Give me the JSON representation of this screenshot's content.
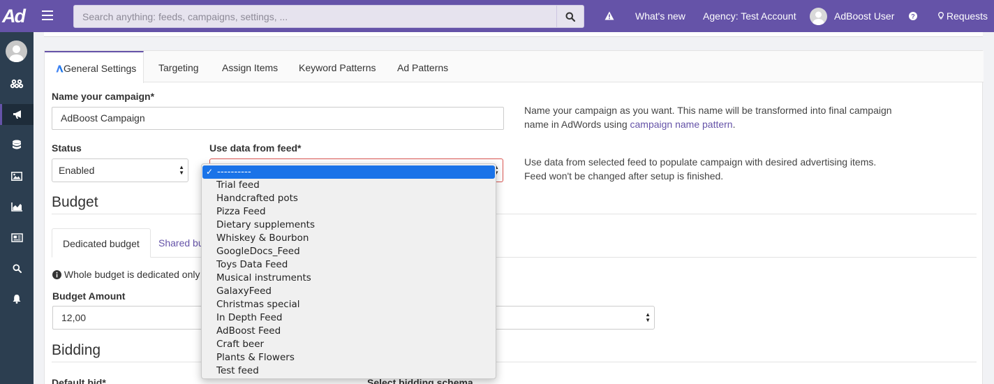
{
  "topbar": {
    "logo": "Ad",
    "search_placeholder": "Search anything: feeds, campaigns, settings, ...",
    "whats_new": "What's new",
    "agency": "Agency: Test Account",
    "user": "AdBoost User",
    "requests": "Requests"
  },
  "tabs": [
    "General Settings",
    "Targeting",
    "Assign Items",
    "Keyword Patterns",
    "Ad Patterns"
  ],
  "form": {
    "campaign_name_label": "Name your campaign*",
    "campaign_name_value": "AdBoost Campaign",
    "campaign_help_text": "Name your campaign as you want. This name will be transformed into final campaign name in AdWords using ",
    "campaign_help_link": "campaign name pattern",
    "campaign_help_end": ".",
    "status_label": "Status",
    "status_value": "Enabled",
    "feed_label": "Use data from feed*",
    "feed_help_text": "Use data from selected feed to populate campaign with desired advertising items. Feed won't be changed after setup is finished."
  },
  "budget": {
    "title": "Budget",
    "tabs": [
      "Dedicated budget",
      "Shared bud"
    ],
    "info_text": "Whole budget is dedicated only to",
    "amount_label": "Budget Amount",
    "amount_value": "12,00"
  },
  "bidding": {
    "title": "Bidding",
    "default_bid_label": "Default bid*",
    "schema_label": "Select bidding schema"
  },
  "feed_dropdown": {
    "selected": "----------",
    "options": [
      "----------",
      "Trial feed",
      "Handcrafted pots",
      "Pizza Feed",
      "Dietary supplements",
      "Whiskey & Bourbon",
      "GoogleDocs_Feed",
      "Toys Data Feed",
      "Musical instruments",
      "GalaxyFeed",
      "Christmas special",
      "In Depth Feed",
      "AdBoost Feed",
      "Craft beer",
      "Plants & Flowers",
      "Test feed"
    ]
  },
  "colors": {
    "brand": "#6553a8",
    "sidebar": "#2c3e50",
    "selection": "#1a73e8",
    "error_border": "#d9534f"
  },
  "sidebar_icons": [
    "user-avatar",
    "feeds-icon",
    "campaigns-icon",
    "database-icon",
    "image-icon",
    "chart-icon",
    "newspaper-icon",
    "search-icon",
    "bell-icon"
  ]
}
